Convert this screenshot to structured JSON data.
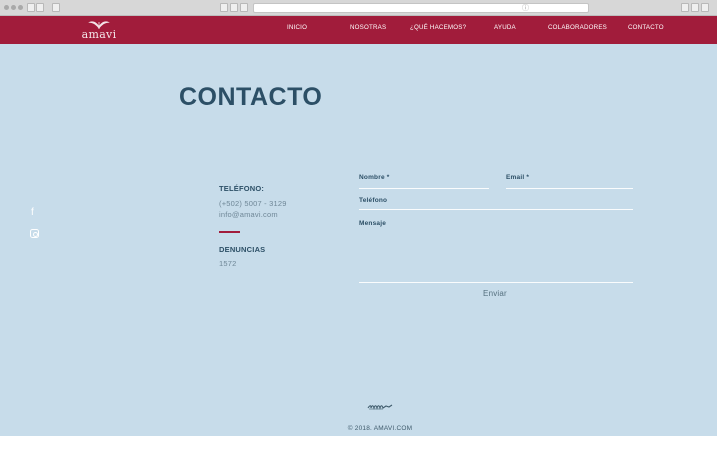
{
  "nav": {
    "logo_text": "amavi",
    "items": [
      "INICIO",
      "NOSOTRAS",
      "¿QUÉ HACEMOS?",
      "AYUDA",
      "COLABORADORES",
      "CONTACTO"
    ]
  },
  "social": {
    "facebook": "f"
  },
  "page": {
    "title": "CONTACTO"
  },
  "info": {
    "phone_label": "TELÉFONO:",
    "phone": "(+502) 5007 - 3129",
    "email": "info@amavi.com",
    "complaints_label": "DENUNCIAS",
    "complaints_number": "1572"
  },
  "form": {
    "name_label": "Nombre *",
    "email_label": "Email *",
    "phone_label": "Teléfono",
    "message_label": "Mensaje",
    "submit_label": "Enviar"
  },
  "footer": {
    "copyright": "© 2018. AMAVI.COM"
  },
  "icons": [
    "facebook-icon",
    "instagram-icon",
    "amavi-logo-icon",
    "footer-ornament-icon",
    "info-icon"
  ],
  "colors": {
    "brand": "#a11c3b",
    "background": "#c7dcea",
    "heading": "#2c4f66"
  }
}
